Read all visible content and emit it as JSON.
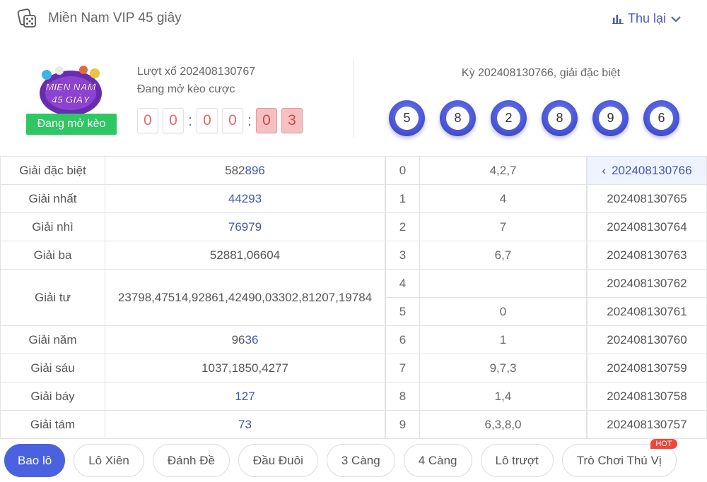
{
  "header": {
    "title": "Miền Nam VIP 45 giây",
    "collapse_label": "Thu lại"
  },
  "info": {
    "logo_text_line1": "MIỀN NAM",
    "logo_text_line2": "45 GIÂY",
    "status": "Đang mở kèo",
    "round": "Lượt xổ 202408130767",
    "betting": "Đang mở kèo cược",
    "countdown": [
      "0",
      "0",
      "0",
      "0",
      "0",
      "3"
    ],
    "separator": ":"
  },
  "result": {
    "title": "Kỳ 202408130766, giải đặc biệt",
    "balls": [
      "5",
      "8",
      "2",
      "8",
      "9",
      "6"
    ]
  },
  "prizes": [
    {
      "name": "Giải đặc biệt",
      "plain": "582",
      "hl": "896"
    },
    {
      "name": "Giải nhất",
      "plain": "",
      "hl": "44293"
    },
    {
      "name": "Giải nhì",
      "plain": "",
      "hl": "76979"
    },
    {
      "name": "Giải ba",
      "value": "52881,06604"
    },
    {
      "name": "Giải tư",
      "value": "23798,47514,92861,42490,03302,81207,19784"
    },
    {
      "name": "Giải năm",
      "plain": "96",
      "hl": "36"
    },
    {
      "name": "Giải sáu",
      "value": "1037,1850,4277"
    },
    {
      "name": "Giải báy",
      "plain": "",
      "hl": "127"
    },
    {
      "name": "Giải tám",
      "plain": "",
      "hl": "73"
    }
  ],
  "heads": [
    {
      "head": "0",
      "tails": "4,2,7"
    },
    {
      "head": "1",
      "tails": "4"
    },
    {
      "head": "2",
      "tails": "7"
    },
    {
      "head": "3",
      "tails": "6,7"
    },
    {
      "head": "4",
      "tails": ""
    },
    {
      "head": "5",
      "tails": "0"
    },
    {
      "head": "6",
      "tails": "1"
    },
    {
      "head": "7",
      "tails": "9,7,3"
    },
    {
      "head": "8",
      "tails": "1,4"
    },
    {
      "head": "9",
      "tails": "6,3,8,0"
    }
  ],
  "periods": [
    "202408130766",
    "202408130765",
    "202408130764",
    "202408130763",
    "202408130762",
    "202408130761",
    "202408130760",
    "202408130759",
    "202408130758",
    "202408130757"
  ],
  "tabs": [
    "Bao lô",
    "Lô Xiên",
    "Đánh Đề",
    "Đầu Đuôi",
    "3 Càng",
    "4 Càng",
    "Lô trượt",
    "Trò Chơi Thú Vị"
  ],
  "hot_badge": "HOT",
  "colors": {
    "accent": "#4a62e0",
    "status_green": "#2ec763",
    "hot_red": "#f0463c"
  },
  "icons": {
    "game": "dice-icon",
    "collapse": "bar-chart-icon",
    "dropdown": "chevron-down-icon",
    "selected_period": "chevron-left-icon"
  }
}
